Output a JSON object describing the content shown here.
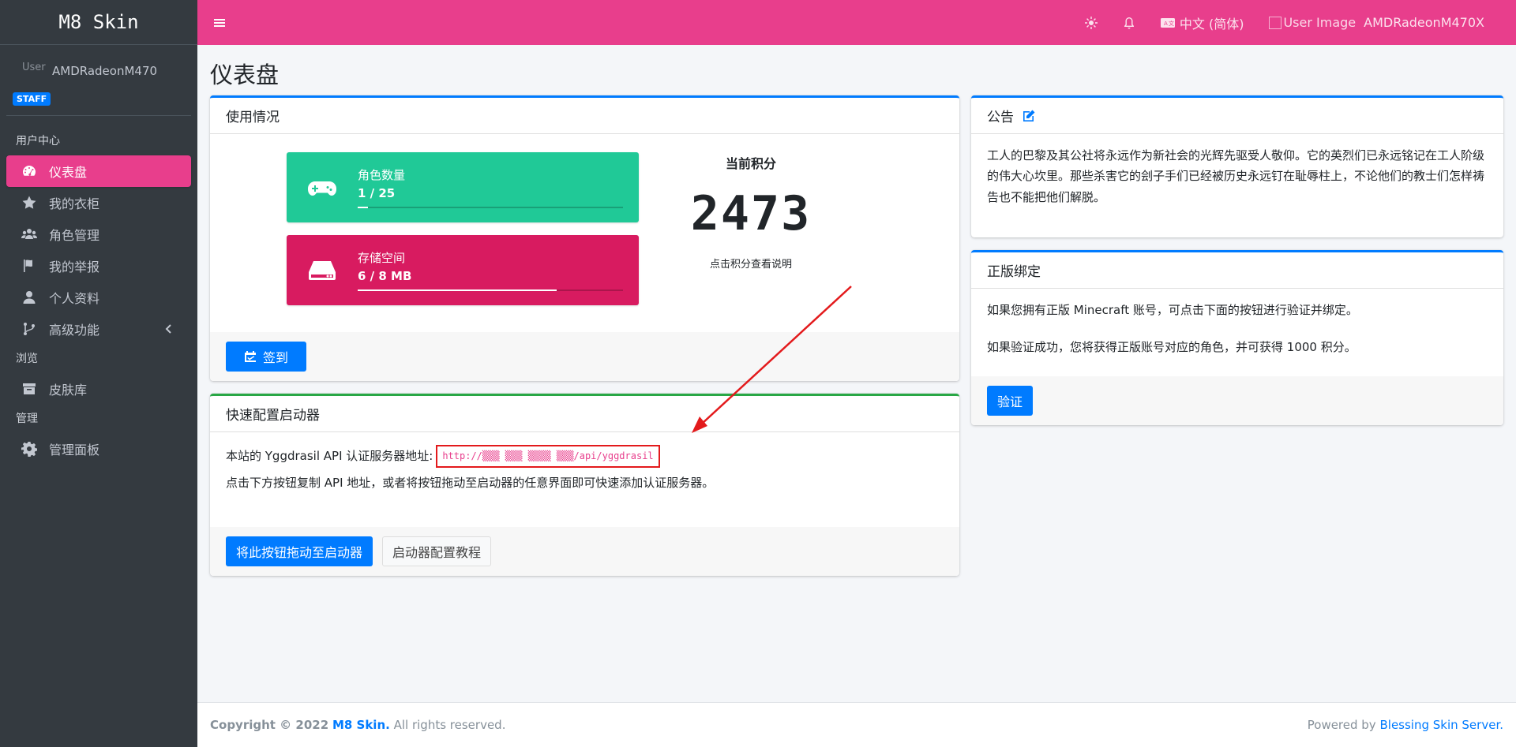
{
  "brand": "M8 Skin",
  "user": {
    "image_alt": "User Image",
    "name": "AMDRadeonM470X",
    "name_truncated": "AMDRadeonM470",
    "badge": "STAFF"
  },
  "sidebar": {
    "sections": [
      {
        "header": "用户中心"
      },
      {
        "header": "浏览"
      },
      {
        "header": "管理"
      }
    ],
    "items": [
      {
        "label": "仪表盘",
        "icon": "dashboard-icon",
        "active": true
      },
      {
        "label": "我的衣柜",
        "icon": "star-icon"
      },
      {
        "label": "角色管理",
        "icon": "users-icon"
      },
      {
        "label": "我的举报",
        "icon": "flag-icon"
      },
      {
        "label": "个人资料",
        "icon": "user-icon"
      },
      {
        "label": "高级功能",
        "icon": "branch-icon"
      },
      {
        "label": "皮肤库",
        "icon": "archive-icon"
      },
      {
        "label": "管理面板",
        "icon": "gear-icon"
      }
    ]
  },
  "topbar": {
    "language": "中文 (简体)",
    "user_image_alt": "User Image",
    "user_name": "AMDRadeonM470X"
  },
  "page_title": "仪表盘",
  "usage": {
    "title": "使用情况",
    "players": {
      "label": "角色数量",
      "value": "1 / 25",
      "fraction": 0.04
    },
    "storage": {
      "label": "存储空间",
      "value": "6 / 8 MB",
      "fraction": 0.75
    },
    "score_label": "当前积分",
    "score": "2473",
    "score_hint": "点击积分查看说明",
    "sign_button": "签到"
  },
  "launcher": {
    "title": "快速配置启动器",
    "api_prefix": "本站的 Yggdrasil API 认证服务器地址:",
    "api_url": "http://▒▒▒ ▒▒▒ ▒▒▒▒ ▒▒▒/api/yggdrasil",
    "hint": "点击下方按钮复制 API 地址，或者将按钮拖动至启动器的任意界面即可快速添加认证服务器。",
    "drag_button": "将此按钮拖动至启动器",
    "tutorial_button": "启动器配置教程"
  },
  "announcement": {
    "title": "公告",
    "body": "工人的巴黎及其公社将永远作为新社会的光辉先驱受人敬仰。它的英烈们已永远铭记在工人阶级的伟大心坎里。那些杀害它的刽子手们已经被历史永远钉在耻辱柱上，不论他们的教士们怎样祷告也不能把他们解脱。"
  },
  "binding": {
    "title": "正版绑定",
    "line1": "如果您拥有正版 Minecraft 账号，可点击下面的按钮进行验证并绑定。",
    "line2": "如果验证成功，您将获得正版账号对应的角色，并可获得 1000 积分。",
    "verify_button": "验证"
  },
  "footer": {
    "copyright": "Copyright © 2022",
    "site": "M8 Skin.",
    "rights": "All rights reserved.",
    "powered": "Powered by",
    "powered_link": "Blessing Skin Server."
  },
  "colors": {
    "accent": "#e83e8c",
    "primary": "#007bff",
    "teal": "#20c997",
    "crimson": "#d81b60",
    "sidebar": "#343a40",
    "annotation_red": "#e31a1c"
  }
}
